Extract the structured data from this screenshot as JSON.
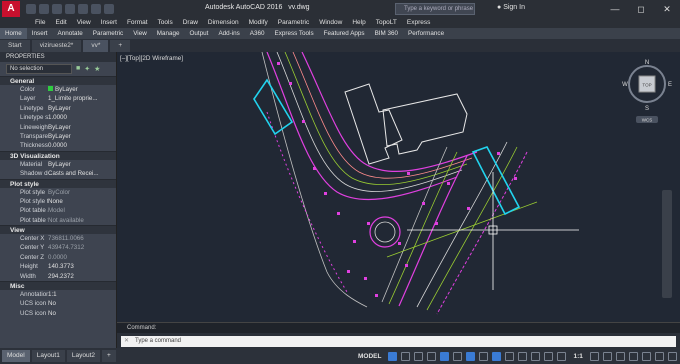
{
  "app": {
    "title": "Autodesk AutoCAD 2016",
    "filename": "vv.dwg",
    "logo": "A",
    "search_placeholder": "Type a keyword or phrase",
    "signin": "Sign In"
  },
  "menu": [
    "File",
    "Edit",
    "View",
    "Insert",
    "Format",
    "Tools",
    "Draw",
    "Dimension",
    "Modify",
    "Parametric",
    "Window",
    "Help",
    "TopoLT",
    "Express"
  ],
  "ribbon_tabs": [
    "Home",
    "Insert",
    "Annotate",
    "Parametric",
    "View",
    "Manage",
    "Output",
    "Add-ins",
    "A360",
    "Express Tools",
    "Featured Apps",
    "BIM 360",
    "Performance"
  ],
  "doc_tabs": [
    "Start",
    "vizirueste2*",
    "vv*"
  ],
  "properties": {
    "title": "PROPERTIES",
    "selection": "No selection",
    "sections": [
      {
        "name": "General",
        "rows": [
          {
            "k": "Color",
            "v": "ByLayer",
            "swatch": true
          },
          {
            "k": "Layer",
            "v": "1_Limite proprie..."
          },
          {
            "k": "Linetype",
            "v": "ByLayer"
          },
          {
            "k": "Linetype sc...",
            "v": "1.0000"
          },
          {
            "k": "Lineweight",
            "v": "ByLayer"
          },
          {
            "k": "Transparency",
            "v": "ByLayer"
          },
          {
            "k": "Thickness",
            "v": "0.0000"
          }
        ]
      },
      {
        "name": "3D Visualization",
        "rows": [
          {
            "k": "Material",
            "v": "ByLayer"
          },
          {
            "k": "Shadow dis...",
            "v": "Casts and Recei..."
          }
        ]
      },
      {
        "name": "Plot style",
        "rows": [
          {
            "k": "Plot style",
            "v": "ByColor",
            "dim": true
          },
          {
            "k": "Plot style t...",
            "v": "None"
          },
          {
            "k": "Plot table a...",
            "v": "Model",
            "dim": true
          },
          {
            "k": "Plot table t...",
            "v": "Not available",
            "dim": true
          }
        ]
      },
      {
        "name": "View",
        "rows": [
          {
            "k": "Center X",
            "v": "736811.0066",
            "dim": true
          },
          {
            "k": "Center Y",
            "v": "439474.7312",
            "dim": true
          },
          {
            "k": "Center Z",
            "v": "0.0000",
            "dim": true
          },
          {
            "k": "Height",
            "v": "140.3773"
          },
          {
            "k": "Width",
            "v": "294.2372"
          }
        ]
      },
      {
        "name": "Misc",
        "rows": [
          {
            "k": "Annotation...",
            "v": "1:1"
          },
          {
            "k": "UCS icon On",
            "v": "No"
          },
          {
            "k": "UCS icon at...",
            "v": "No"
          }
        ]
      }
    ]
  },
  "viewport": {
    "label": "[–][Top][2D Wireframe]",
    "viewcube": {
      "n": "N",
      "s": "S",
      "e": "E",
      "w": "W",
      "top": "TOP"
    },
    "wcs": "WCS"
  },
  "command": {
    "history": "Command:",
    "placeholder": "Type a command"
  },
  "layout_tabs": [
    "Model",
    "Layout1",
    "Layout2"
  ],
  "status": {
    "model": "MODEL",
    "scale": "1:1"
  },
  "colors": {
    "viewport_bg": "#212834",
    "accent_blue": "#3a7bd5"
  }
}
